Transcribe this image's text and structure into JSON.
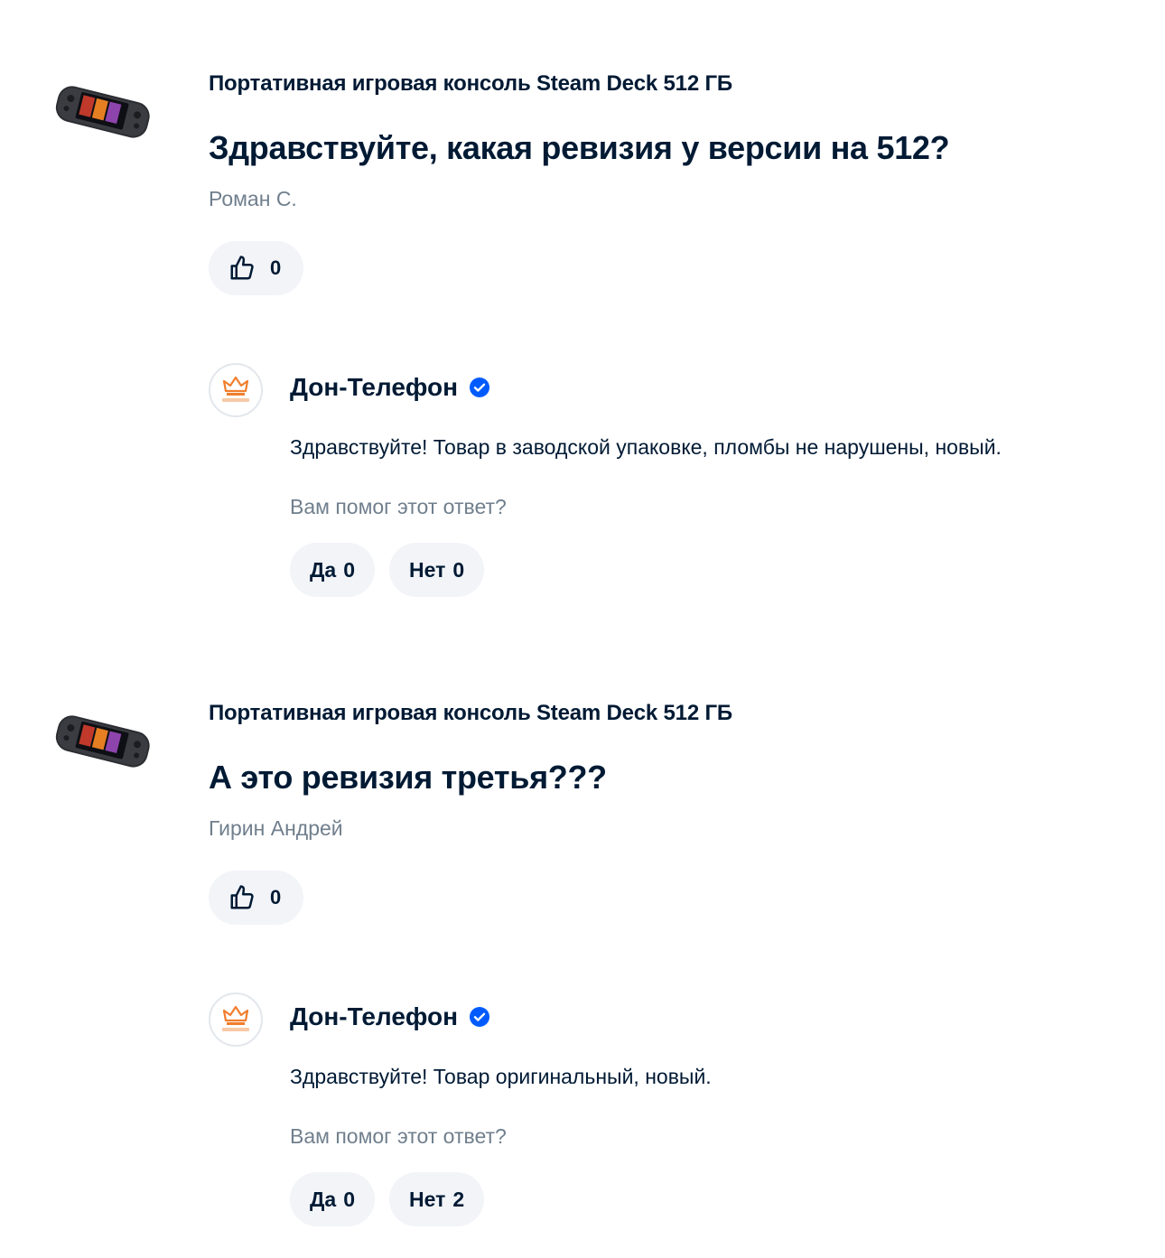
{
  "questions": [
    {
      "product_title": "Портативная игровая консоль Steam Deck 512 ГБ",
      "question": "Здравствуйте, какая ревизия у версии на 512?",
      "author": "Роман С.",
      "likes": "0",
      "answer": {
        "seller": "Дон-Телефон",
        "text": "Здравствуйте! Товар в заводской упаковке, пломбы не нарушены, новый.",
        "helpful_label": "Вам помог этот ответ?",
        "yes_label": "Да",
        "yes_count": "0",
        "no_label": "Нет",
        "no_count": "0"
      }
    },
    {
      "product_title": "Портативная игровая консоль Steam Deck 512 ГБ",
      "question": "А это ревизия третья???",
      "author": "Гирин Андрей",
      "likes": "0",
      "answer": {
        "seller": "Дон-Телефон",
        "text": "Здравствуйте! Товар оригинальный, новый.",
        "helpful_label": "Вам помог этот ответ?",
        "yes_label": "Да",
        "yes_count": "0",
        "no_label": "Нет",
        "no_count": "2"
      }
    }
  ],
  "icons": {
    "like": "thumbs-up-icon",
    "verified": "verified-check-icon",
    "avatar": "crown-logo"
  },
  "colors": {
    "text": "#001a34",
    "muted": "#707f8d",
    "button_bg": "#f2f4f8",
    "verified": "#005bff",
    "logo": "#f07e2d"
  }
}
